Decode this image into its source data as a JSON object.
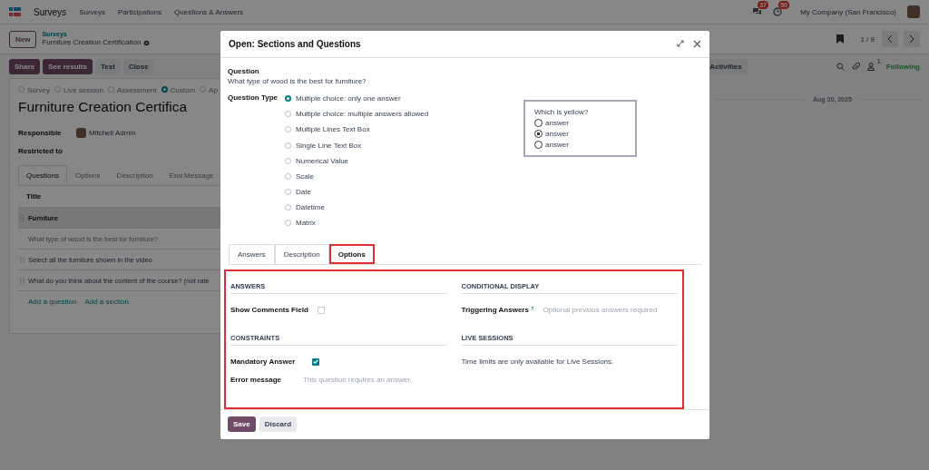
{
  "navbar": {
    "app": "Surveys",
    "menu": [
      "Surveys",
      "Participations",
      "Questions & Answers"
    ],
    "messages_badge": "37",
    "activities_badge": "50",
    "company": "My Company (San Francisco)"
  },
  "control_panel": {
    "new_button": "New",
    "breadcrumb_parent": "Surveys",
    "breadcrumb_current": "Furniture Creation Certification",
    "pager": "1 / 9"
  },
  "form_buttons": [
    {
      "label": "Share",
      "kind": "primary"
    },
    {
      "label": "See results",
      "kind": "primary"
    },
    {
      "label": "Test",
      "kind": "secondary"
    },
    {
      "label": "Close",
      "kind": "secondary"
    }
  ],
  "chatter": {
    "activities_button": "Activities",
    "followers_count": "1",
    "following": "Following",
    "date_divider": "Aug 20, 2025"
  },
  "survey_types": [
    {
      "label": "Survey",
      "selected": false
    },
    {
      "label": "Live session",
      "selected": false
    },
    {
      "label": "Assessment",
      "selected": false
    },
    {
      "label": "Custom",
      "selected": true
    },
    {
      "label": "Ap",
      "selected": false
    }
  ],
  "title": "Furniture Creation Certifica",
  "responsible": {
    "label": "Responsible",
    "value": "Mitchell Admin"
  },
  "restricted_to": {
    "label": "Restricted to"
  },
  "form_tabs": [
    {
      "label": "Questions",
      "selected": true
    },
    {
      "label": "Options",
      "selected": false
    },
    {
      "label": "Description",
      "selected": false
    },
    {
      "label": "End Message",
      "selected": false
    }
  ],
  "table": {
    "columns": [
      "Title"
    ],
    "rows": [
      {
        "title": "Furniture",
        "kind": "section"
      },
      {
        "title": "What type of wood is the best for furniture?",
        "kind": "editing"
      },
      {
        "title": "Select all the furniture shown in the video",
        "kind": "question"
      },
      {
        "title": "What do you think about the content of the course? (not rate",
        "kind": "question"
      }
    ],
    "links": [
      "Add a question",
      "Add a section"
    ]
  },
  "dialog": {
    "title": "Open: Sections and Questions",
    "question_label": "Question",
    "question": "What type of wood is the best for furniture?",
    "question_type_label": "Question Type",
    "question_types": [
      {
        "label": "Multiple choice: only one answer",
        "selected": true
      },
      {
        "label": "Multiple choice: multiple answers allowed",
        "selected": false
      },
      {
        "label": "Multiple Lines Text Box",
        "selected": false
      },
      {
        "label": "Single Line Text Box",
        "selected": false
      },
      {
        "label": "Numerical Value",
        "selected": false
      },
      {
        "label": "Scale",
        "selected": false
      },
      {
        "label": "Date",
        "selected": false
      },
      {
        "label": "Datetime",
        "selected": false
      },
      {
        "label": "Matrix",
        "selected": false
      }
    ],
    "preview": {
      "title": "Which is yellow?",
      "answers": [
        {
          "label": "answer",
          "selected": false
        },
        {
          "label": "answer",
          "selected": true
        },
        {
          "label": "answer",
          "selected": false
        }
      ]
    },
    "tabs": [
      {
        "label": "Answers",
        "selected": false,
        "highlighted": false
      },
      {
        "label": "Description",
        "selected": false,
        "highlighted": false
      },
      {
        "label": "Options",
        "selected": true,
        "highlighted": true
      }
    ],
    "options": {
      "highlighted": true,
      "left": [
        {
          "title": "ANSWERS",
          "fields": [
            {
              "kind": "checkbox",
              "label": "Show Comments Field",
              "checked": false
            }
          ]
        },
        {
          "title": "CONSTRAINTS",
          "fields": [
            {
              "kind": "checkbox",
              "label": "Mandatory Answer",
              "checked": true
            },
            {
              "kind": "input",
              "label": "Error message",
              "placeholder": "This question requires an answer."
            }
          ]
        }
      ],
      "right": [
        {
          "title": "CONDITIONAL DISPLAY",
          "fields": [
            {
              "kind": "input",
              "label": "Triggering Answers",
              "help": "?",
              "placeholder": "Optional previous answers required"
            }
          ]
        },
        {
          "title": "LIVE SESSIONS",
          "fields": [
            {
              "kind": "note",
              "text": "Time limits are only available for Live Sessions."
            }
          ]
        }
      ]
    },
    "buttons": [
      {
        "label": "Save",
        "kind": "primary"
      },
      {
        "label": "Discard",
        "kind": "secondary"
      }
    ]
  }
}
